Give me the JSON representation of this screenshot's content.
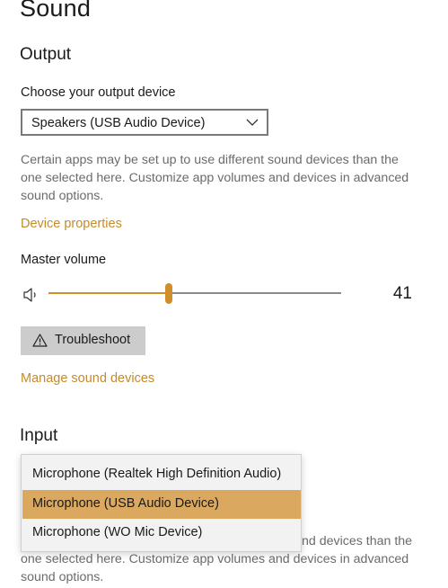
{
  "page": {
    "title": "Sound"
  },
  "output": {
    "heading": "Output",
    "device_label": "Choose your output device",
    "selected_device": "Speakers (USB Audio Device)",
    "description_line1": "Certain apps may be set up to use different sound devices than the",
    "description_line2": "one selected here. Customize app volumes and devices in advanced",
    "description_line3": "sound options.",
    "device_properties_link": "Device properties",
    "master_volume_label": "Master volume",
    "volume": 41,
    "volume_text": "41",
    "troubleshoot_label": "Troubleshoot",
    "manage_devices_link": "Manage sound devices"
  },
  "input": {
    "heading": "Input",
    "options": [
      "Microphone (Realtek High Definition Audio)",
      "Microphone (USB Audio Device)",
      "Microphone (WO Mic Device)"
    ],
    "selected_index": 1,
    "description_line1_tail": "nd devices than the",
    "description_line2": "one selected here. Customize app volumes and devices in advanced",
    "description_line3": "sound options."
  },
  "colors": {
    "accent": "#d08f2c",
    "link": "#c58a2a",
    "selected_option": "#dba85f",
    "button": "#cccccc"
  },
  "icons": {
    "speaker": "speaker-icon",
    "chevron": "chevron-down-icon",
    "warning": "warning-icon"
  }
}
